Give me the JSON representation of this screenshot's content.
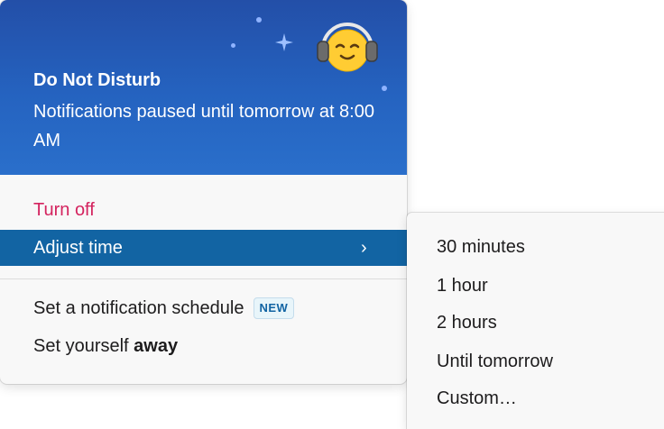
{
  "dnd_menu": {
    "header": {
      "title": "Do Not Disturb",
      "subtitle": "Notifications paused until tomorrow at 8:00 AM",
      "emoji_icon": "headphones-smiling-face-icon"
    },
    "items": {
      "turn_off": "Turn off",
      "adjust_time": "Adjust time",
      "adjust_time_chevron": "›",
      "notification_schedule": "Set a notification schedule",
      "new_badge": "NEW",
      "set_away_prefix": "Set yourself",
      "set_away_bold": "away"
    }
  },
  "adjust_time_submenu": {
    "options": [
      "30 minutes",
      "1 hour",
      "2 hours",
      "Until tomorrow",
      "Custom…"
    ]
  },
  "colors": {
    "header_blue": "#2563c0",
    "highlight_blue": "#1264a3",
    "turn_off_red": "#d4245f",
    "badge_text": "#1264a3",
    "menu_bg": "#f8f8f8"
  }
}
